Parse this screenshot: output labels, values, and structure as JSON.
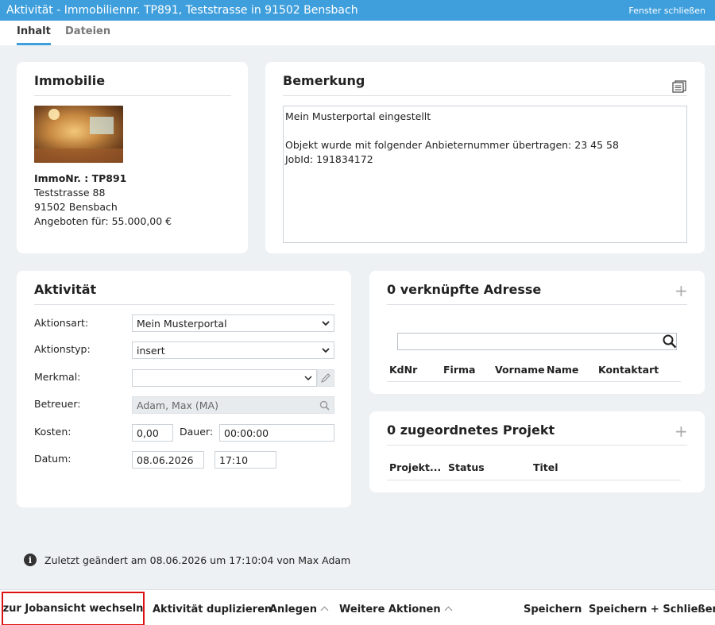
{
  "window": {
    "title": "Aktivität - Immobiliennr. TP891, Teststrasse in 91502 Bensbach",
    "close_label": "Fenster schließen"
  },
  "tabs": [
    {
      "label": "Inhalt",
      "active": true
    },
    {
      "label": "Dateien",
      "active": false
    }
  ],
  "immobilie": {
    "heading": "Immobilie",
    "immonr": "ImmoNr. : TP891",
    "street": "Teststrasse 88",
    "city": "91502 Bensbach",
    "price": "Angeboten für: 55.000,00 €"
  },
  "bemerkung": {
    "heading": "Bemerkung",
    "lines": [
      "Mein Musterportal eingestellt",
      "",
      "Objekt wurde mit folgender Anbieternummer übertragen: 23 45 58",
      "JobId: 191834172"
    ]
  },
  "aktivitaet": {
    "heading": "Aktivität",
    "aktionsart_label": "Aktionsart:",
    "aktionsart_value": "Mein Musterportal",
    "aktionstyp_label": "Aktionstyp:",
    "aktionstyp_value": "insert",
    "merkmal_label": "Merkmal:",
    "merkmal_value": "",
    "betreuer_label": "Betreuer:",
    "betreuer_value": "Adam, Max (MA)",
    "kosten_label": "Kosten:",
    "kosten_value": "0,00",
    "dauer_label": "Dauer:",
    "dauer_value": "00:00:00",
    "datum_label": "Datum:",
    "datum_value": "08.06.2026",
    "zeit_value": "17:10"
  },
  "adressen": {
    "heading": "0 verknüpfte Adresse",
    "search_value": "",
    "columns": [
      "KdNr",
      "Firma",
      "Vorname",
      "Name",
      "Kontaktart"
    ]
  },
  "projekte": {
    "heading": "0 zugeordnetes Projekt",
    "columns": [
      "Projekt...",
      "Status",
      "Titel"
    ]
  },
  "info": {
    "text": "Zuletzt geändert am 08.06.2026 um 17:10:04 von Max Adam"
  },
  "footer": {
    "jobansicht": "zur Jobansicht wechseln",
    "duplizieren": "Aktivität duplizieren",
    "anlegen": "Anlegen",
    "weitere": "Weitere Aktionen",
    "speichern": "Speichern",
    "speichern_schliessen": "Speichern + Schließen"
  },
  "colors": {
    "accent": "#3f9fdc",
    "highlight_border": "#d11111"
  },
  "icons": [
    "note-icon",
    "search-icon",
    "pencil-icon",
    "plus-icon",
    "info-icon",
    "chevron-down-icon",
    "chevron-up-icon"
  ]
}
